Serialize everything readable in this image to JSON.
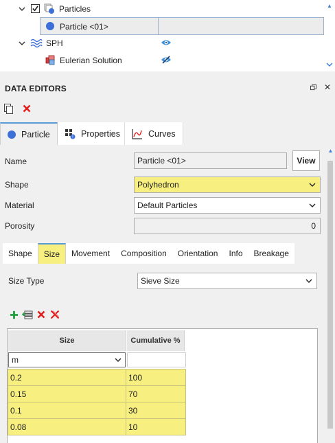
{
  "tree": {
    "items": [
      {
        "label": "Particles",
        "checked": true
      },
      {
        "label": "Particle <01>"
      },
      {
        "label": "SPH"
      },
      {
        "label": "Eulerian Solution"
      }
    ]
  },
  "editor": {
    "title": "DATA EDITORS",
    "main_tabs": [
      {
        "label": "Particle",
        "icon": "particle-dot-icon"
      },
      {
        "label": "Properties",
        "icon": "properties-grid-icon"
      },
      {
        "label": "Curves",
        "icon": "curves-chart-icon"
      }
    ],
    "name_label": "Name",
    "name_value": "Particle <01>",
    "view_button": "View",
    "shape_label": "Shape",
    "shape_value": "Polyhedron",
    "material_label": "Material",
    "material_value": "Default Particles",
    "porosity_label": "Porosity",
    "porosity_value": "0",
    "sub_tabs": [
      "Shape",
      "Size",
      "Movement",
      "Composition",
      "Orientation",
      "Info",
      "Breakage"
    ],
    "size_type_label": "Size Type",
    "size_type_value": "Sieve Size",
    "grid": {
      "headers": [
        "Size",
        "Cumulative %"
      ],
      "unit": "m",
      "rows": [
        {
          "size": "0.2",
          "cumulative": "100"
        },
        {
          "size": "0.15",
          "cumulative": "70"
        },
        {
          "size": "0.1",
          "cumulative": "30"
        },
        {
          "size": "0.08",
          "cumulative": "10"
        }
      ]
    }
  },
  "colors": {
    "highlight": "#f7ef80",
    "accent": "#5b9bd5",
    "delete": "#e02020",
    "add": "#1e9e3e",
    "particle_dot": "#3d6fd8"
  }
}
